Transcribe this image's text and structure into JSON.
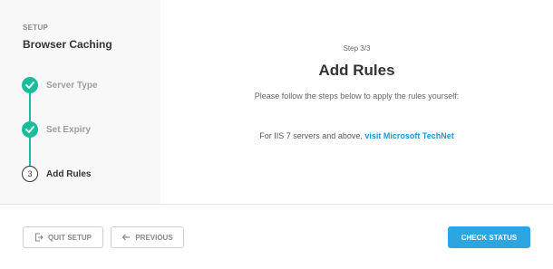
{
  "sidebar": {
    "setup_label": "SETUP",
    "title": "Browser Caching",
    "steps": [
      {
        "label": "Server Type",
        "state": "done",
        "icon": "check-icon"
      },
      {
        "label": "Set Expiry",
        "state": "done",
        "icon": "check-icon"
      },
      {
        "label": "Add Rules",
        "state": "current",
        "number": "3"
      }
    ]
  },
  "main": {
    "step_counter": "Step 3/3",
    "title": "Add Rules",
    "instruction": "Please follow the steps below to apply the rules yourself:",
    "iis_text": "For IIS 7 servers and above,",
    "iis_link": "visit Microsoft TechNet"
  },
  "footer": {
    "quit_label": "QUIT SETUP",
    "quit_icon": "exit-icon",
    "previous_label": "PREVIOUS",
    "previous_icon": "arrow-left-icon",
    "check_label": "CHECK STATUS"
  },
  "colors": {
    "accent_green": "#1abc9c",
    "primary_blue": "#2da5e0",
    "link_blue": "#2196d3",
    "sidebar_bg": "#f8f8f8"
  }
}
